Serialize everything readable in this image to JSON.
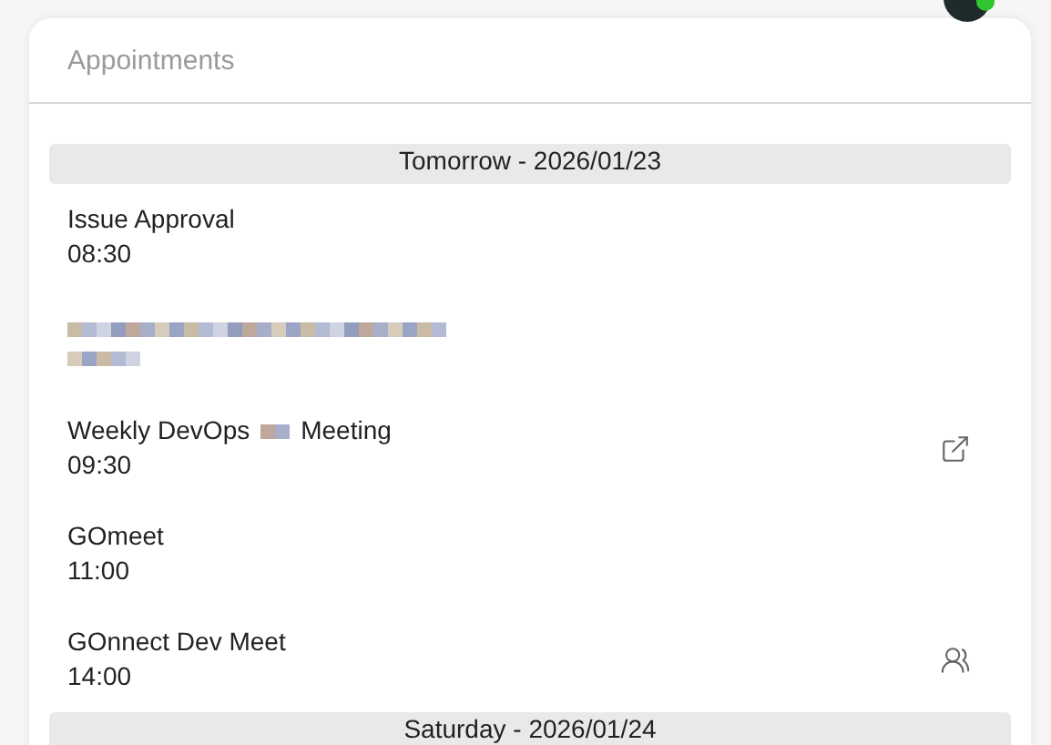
{
  "account": {
    "online": true
  },
  "header": {
    "title": "Appointments"
  },
  "days": [
    {
      "label": "Tomorrow - 2026/01/23",
      "appointments": [
        {
          "kind": "event",
          "title": "Issue Approval",
          "time": "08:30"
        },
        {
          "kind": "redacted"
        },
        {
          "kind": "event",
          "title": "Weekly DevOps",
          "title_after": "Meeting",
          "time": "09:30",
          "external_link": true
        },
        {
          "kind": "event",
          "title": "GOmeet",
          "time": "11:00"
        },
        {
          "kind": "event",
          "title": "GOnnect Dev Meet",
          "time": "14:00",
          "attendees": true
        }
      ]
    },
    {
      "label": "Saturday - 2026/01/24"
    }
  ]
}
